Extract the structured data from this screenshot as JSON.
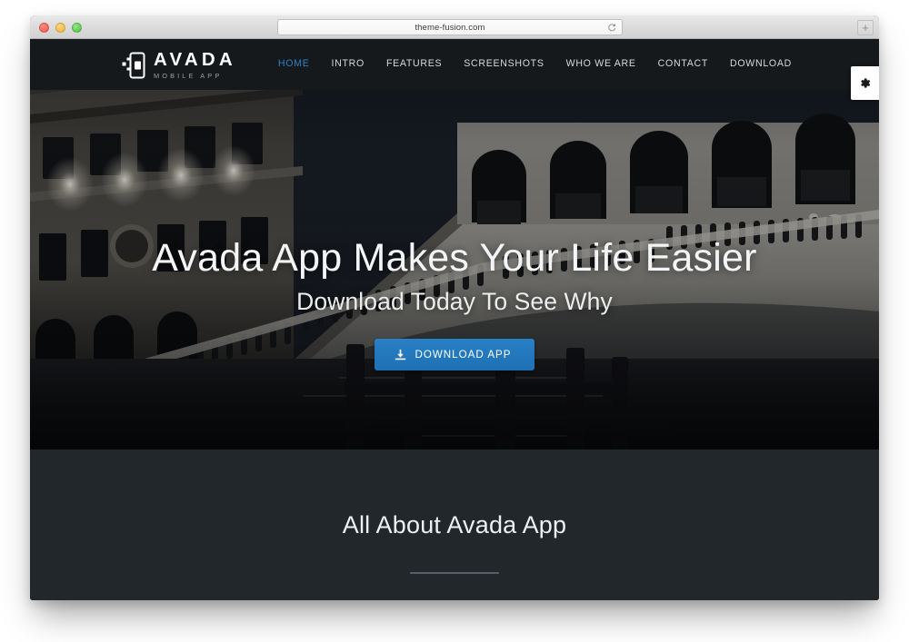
{
  "browser": {
    "url": "theme-fusion.com",
    "reload_icon": "reload-icon",
    "new_tab_label": "+",
    "traffic_lights": [
      "close",
      "minimize",
      "zoom"
    ]
  },
  "site": {
    "logo": {
      "icon": "mobile-phone-share-icon",
      "title": "AVADA",
      "subtitle": "MOBILE APP"
    },
    "nav": {
      "items": [
        {
          "label": "HOME",
          "active": true
        },
        {
          "label": "INTRO",
          "active": false
        },
        {
          "label": "FEATURES",
          "active": false
        },
        {
          "label": "SCREENSHOTS",
          "active": false
        },
        {
          "label": "WHO WE ARE",
          "active": false
        },
        {
          "label": "CONTACT",
          "active": false
        },
        {
          "label": "DOWNLOAD",
          "active": false
        }
      ]
    },
    "settings_tab": {
      "icon": "gear-icon"
    },
    "hero": {
      "image_alt": "Rialto Bridge Venice at night, dark monochrome photograph with wooden mooring posts in canal water",
      "title": "Avada App Makes Your Life Easier",
      "subtitle": "Download Today To See Why",
      "cta": {
        "label": "DOWNLOAD APP",
        "icon": "download-icon"
      }
    },
    "about": {
      "title": "All About Avada App",
      "divider": true
    }
  },
  "colors": {
    "accent_blue": "#2a80c6",
    "nav_active": "#2f80c2",
    "header_bg": "#15191c",
    "section_bg": "#22272b",
    "hero_text": "#f4f5f6",
    "divider": "#565e63"
  }
}
